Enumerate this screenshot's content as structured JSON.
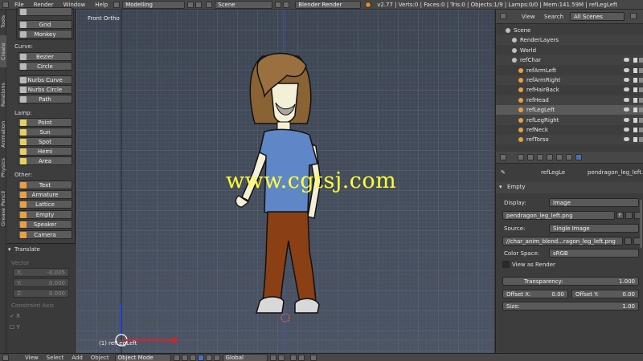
{
  "menu": [
    "File",
    "Render",
    "Window",
    "Help"
  ],
  "layout": "Modelling",
  "scene": "Scene",
  "render_engine": "Blender Render",
  "stats": "v2.77 | Verts:0 | Faces:0 | Tris:0 | Objects:1/9 | Lamps:0/0 | Mem:141.59M | refLegLeft",
  "tool_tabs": [
    "Tools",
    "Create",
    "Relations",
    "Animation",
    "Physics",
    "Grease Pencil"
  ],
  "mesh_buttons": [
    "Grid",
    "Monkey"
  ],
  "curve": {
    "label": "Curve:",
    "buttons": [
      "Bezier",
      "Circle",
      "Nurbs Curve",
      "Nurbs Circle",
      "Path"
    ]
  },
  "lamp": {
    "label": "Lamp:",
    "buttons": [
      "Point",
      "Sun",
      "Spot",
      "Hemi",
      "Area"
    ]
  },
  "other": {
    "label": "Other:",
    "buttons": [
      "Text",
      "Armature",
      "Lattice",
      "Empty",
      "Speaker",
      "Camera"
    ]
  },
  "redo": {
    "title": "Translate",
    "vector_label": "Vector",
    "x_label": "X:",
    "x_value": "-0.005",
    "y_label": "Y:",
    "y_value": "0.000",
    "z_label": "Z:",
    "z_value": "0.000",
    "constraint_label": "Constraint Axis",
    "axis_x": "X",
    "axis_y": "Y"
  },
  "viewport": {
    "label": "Front Ortho",
    "object_label": "(1) refLegLeft",
    "watermark": "www.cgtsj.com"
  },
  "bottom": {
    "menus": [
      "View",
      "Select",
      "Add",
      "Object"
    ],
    "mode": "Object Mode",
    "orientation": "Global"
  },
  "outliner": {
    "menus": [
      "View",
      "Search"
    ],
    "filter": "All Scenes",
    "rows": [
      {
        "name": "Scene",
        "indent": 1
      },
      {
        "name": "RenderLayers",
        "indent": 2
      },
      {
        "name": "World",
        "indent": 2
      },
      {
        "name": "refChar",
        "indent": 2
      },
      {
        "name": "refArmLeft",
        "indent": 3
      },
      {
        "name": "refArmRight",
        "indent": 3
      },
      {
        "name": "refHairBack",
        "indent": 3
      },
      {
        "name": "refHead",
        "indent": 3
      },
      {
        "name": "refLegLeft",
        "indent": 3
      },
      {
        "name": "refLegRight",
        "indent": 3
      },
      {
        "name": "refNeck",
        "indent": 3
      },
      {
        "name": "refTorso",
        "indent": 3
      }
    ]
  },
  "properties": {
    "breadcrumb_obj": "refLegLe",
    "breadcrumb_img": "pendragon_leg_left...",
    "panel": "Empty",
    "display_label": "Display:",
    "display_value": "Image",
    "image_name": "pendragon_leg_left.png",
    "image_flag": "F",
    "source_label": "Source:",
    "source_value": "Single Image",
    "filepath": "//char_anim_blend...ragon_leg_left.png",
    "colorspace_label": "Color Space:",
    "colorspace_value": "sRGB",
    "view_as_render": "View as Render",
    "transparency_label": "Transparency:",
    "transparency_value": "1.000",
    "offset_x_label": "Offset X:",
    "offset_x_value": "0.00",
    "offset_y_label": "Offset Y:",
    "offset_y_value": "0.00",
    "size_label": "Size:",
    "size_value": "1.00"
  }
}
